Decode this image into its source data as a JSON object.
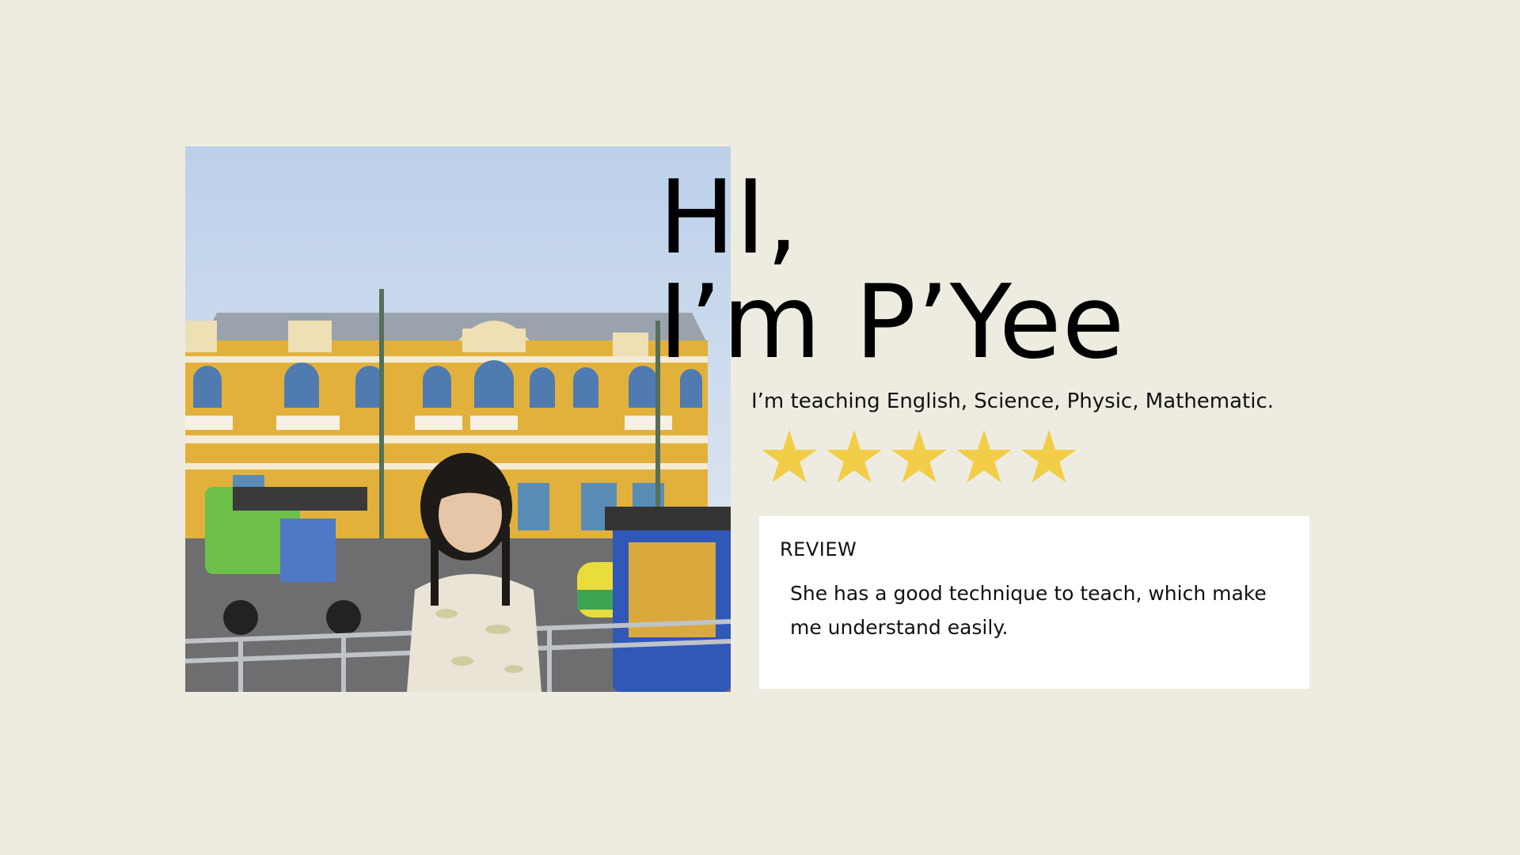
{
  "hero": {
    "greeting_line1": "HI,",
    "greeting_line2": "I’m P’Yee",
    "subjects": "I’m teaching English, Science, Physic, Mathematic."
  },
  "rating": {
    "stars": 5,
    "max": 5,
    "color": "#F2CD48"
  },
  "review": {
    "title": "REVIEW",
    "text": "She has a good technique to teach, which make me understand easily."
  },
  "colors": {
    "background": "#EEECE0",
    "card": "#FFFFFF"
  }
}
